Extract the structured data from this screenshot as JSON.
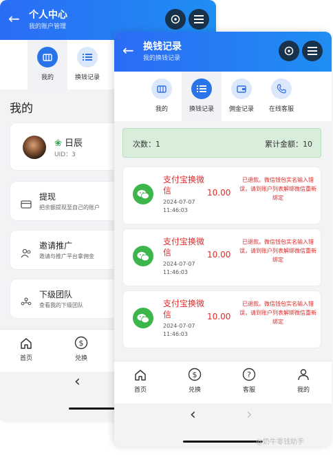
{
  "back_screen": {
    "header": {
      "title": "个人中心",
      "subtitle": "我的账户管理"
    },
    "tabs": [
      {
        "label": "我的",
        "icon": "wallet-icon",
        "active": true
      },
      {
        "label": "换钱记录",
        "icon": "list-icon",
        "active": false
      }
    ],
    "section_title": "我的",
    "profile": {
      "name": "日辰",
      "uid": "UID：3"
    },
    "menu": [
      {
        "title": "提现",
        "desc": "把余额提现至自己的账户",
        "icon": "card-icon"
      },
      {
        "title": "邀请推广",
        "desc": "邀请与推广平台拿佣金",
        "icon": "people-icon"
      },
      {
        "title": "下级团队",
        "desc": "查看我的下级团队",
        "icon": "team-icon"
      }
    ],
    "bottom_nav": [
      {
        "label": "首页",
        "icon": "home-icon"
      },
      {
        "label": "兑换",
        "icon": "dollar-coin-icon"
      }
    ],
    "system_nav": {
      "back": "‹"
    }
  },
  "front_screen": {
    "header": {
      "title": "换钱记录",
      "subtitle": "我的换钱记录"
    },
    "tabs": [
      {
        "label": "我的",
        "icon": "wallet-icon",
        "active": false
      },
      {
        "label": "换钱记录",
        "icon": "list-icon",
        "active": true
      },
      {
        "label": "佣金记录",
        "icon": "purse-icon",
        "active": false
      },
      {
        "label": "在线客服",
        "icon": "phone-icon",
        "active": false
      }
    ],
    "summary": {
      "count_text": "次数：1",
      "total_text": "累计金额：10"
    },
    "records": [
      {
        "title": "支付宝换微信",
        "time": "2024-07-07 11:46:03",
        "amount": "10.00",
        "status": "已退款。微信钱包实名输入错误，请到账户列表解绑微信重新绑定"
      },
      {
        "title": "支付宝换微信",
        "time": "2024-07-07 11:46:03",
        "amount": "10.00",
        "status": "已退款。微信钱包实名输入错误，请到账户列表解绑微信重新绑定"
      },
      {
        "title": "支付宝换微信",
        "time": "2024-07-07 11:46:03",
        "amount": "10.00",
        "status": "已退款。微信钱包实名输入错误，请到账户列表解绑微信重新绑定"
      }
    ],
    "bottom_nav": [
      {
        "label": "首页",
        "icon": "home-icon"
      },
      {
        "label": "兑换",
        "icon": "dollar-coin-icon"
      },
      {
        "label": "客服",
        "icon": "help-icon"
      },
      {
        "label": "我的",
        "icon": "person-icon"
      }
    ],
    "system_nav": {
      "back": "‹",
      "forward": "›"
    }
  },
  "watermark": "@奶牛零钱助手",
  "colors": {
    "header_start": "#2b6cf5",
    "header_end": "#1f8ef3",
    "accent": "#2a74ea",
    "alert_red": "#e02a2a",
    "wechat_green": "#3cb54b",
    "summary_bg": "#d8eedb"
  }
}
